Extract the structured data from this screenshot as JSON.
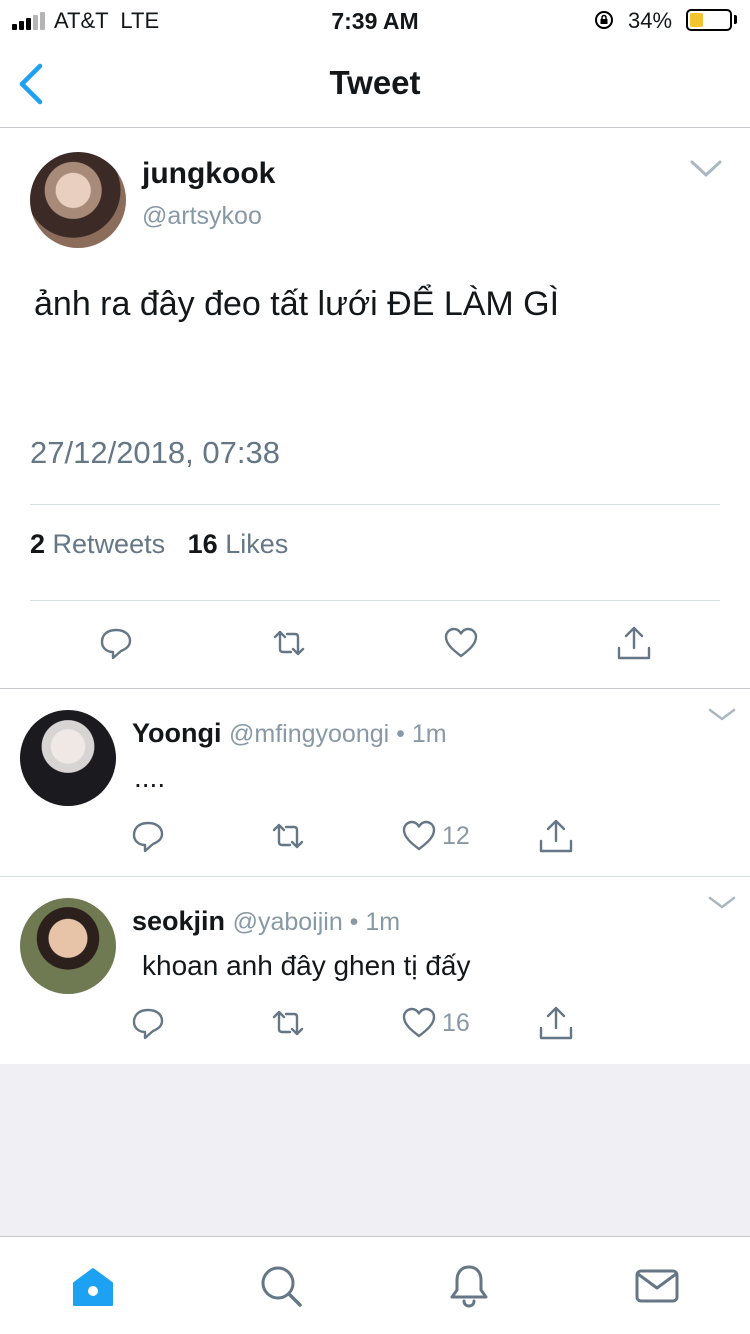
{
  "status_bar": {
    "carrier": "AT&T  LTE",
    "time": "7:39 AM",
    "battery": "34%",
    "battery_level": 0.34
  },
  "nav": {
    "title": "Tweet",
    "back_icon": "chevron-left-icon"
  },
  "tweet": {
    "name": "jungkook",
    "handle": "@artsykoo",
    "text": "ảnh ra đây đeo tất lưới ĐỂ LÀM GÌ",
    "timestamp": "27/12/2018, 07:38",
    "retweets_count": "2",
    "retweets_label": "Retweets",
    "likes_count": "16",
    "likes_label": "Likes"
  },
  "replies": [
    {
      "name": "Yoongi",
      "meta": "@mfingyoongi • 1m",
      "text": "....",
      "likes": "12"
    },
    {
      "name": "seokjin",
      "meta": "@yaboijin • 1m",
      "text": "khoan anh đây ghen tị đấy",
      "likes": "16"
    }
  ],
  "tab_bar": {
    "items": [
      "home-icon",
      "search-icon",
      "notifications-icon",
      "messages-icon"
    ]
  },
  "colors": {
    "accent": "#1da1f2",
    "secondary_text": "#657786",
    "icon_gray": "#8899a6",
    "battery_fill": "#f4c430"
  }
}
